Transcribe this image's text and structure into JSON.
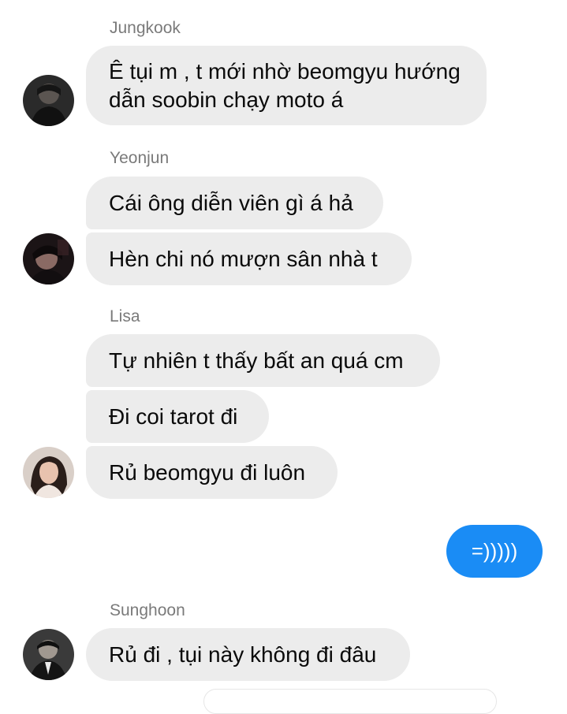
{
  "conversation": {
    "groups": [
      {
        "sender": "Jungkook",
        "avatar_icon": "jungkook-avatar",
        "messages": [
          "Ê tụi m , t mới nhờ beomgyu hướng dẫn soobin chạy moto á"
        ]
      },
      {
        "sender": "Yeonjun",
        "avatar_icon": "yeonjun-avatar",
        "messages": [
          "Cái ông diễn viên gì á hả",
          "Hèn chi nó mượn sân nhà t"
        ]
      },
      {
        "sender": "Lisa",
        "avatar_icon": "lisa-avatar",
        "messages": [
          "Tự nhiên t thấy bất an quá cm",
          "Đi coi tarot đi",
          "Rủ beomgyu đi luôn"
        ]
      },
      {
        "sender": "Sunghoon",
        "avatar_icon": "sunghoon-avatar",
        "messages": [
          "Rủ đi , tụi này không đi đâu"
        ]
      }
    ],
    "outgoing": {
      "text": "=)))))",
      "color": "#1a8cf5"
    }
  },
  "colors": {
    "incoming_bubble": "#ececec",
    "sender_name": "#7a7a7a",
    "background": "#ffffff"
  }
}
